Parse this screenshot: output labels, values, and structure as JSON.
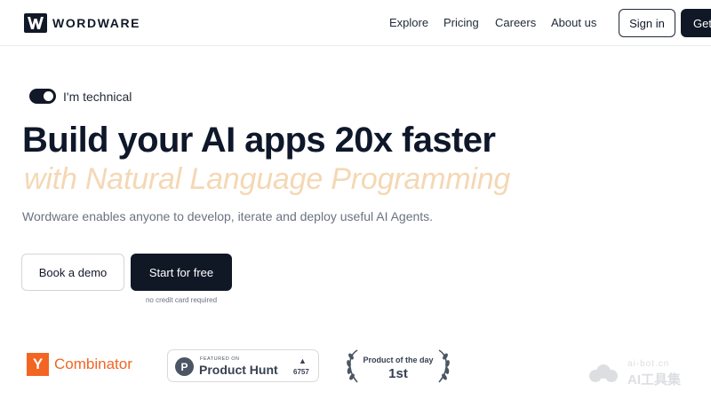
{
  "header": {
    "brand": "WORDWARE",
    "nav": {
      "explore": "Explore",
      "pricing": "Pricing",
      "careers": "Careers",
      "about": "About us"
    },
    "sign_in": "Sign in",
    "get_started": "Get"
  },
  "hero": {
    "toggle_label": "I'm technical",
    "toggle_on": true,
    "headline": "Build your AI apps 20x faster",
    "subheadline": "with Natural Language Programming",
    "description": "Wordware enables anyone to develop, iterate and deploy useful AI Agents.",
    "book_demo": "Book a demo",
    "start_free": "Start for free",
    "no_credit_card": "no credit card required"
  },
  "badges": {
    "ycombinator": {
      "letter": "Y",
      "text": "Combinator"
    },
    "producthunt": {
      "featured": "FEATURED ON",
      "name": "Product Hunt",
      "logo_letter": "P",
      "upvotes": "6757"
    },
    "potd": {
      "title": "Product of the day",
      "rank": "1st"
    }
  },
  "watermark": {
    "small": "ai-bot.cn",
    "big": "AI工具集"
  },
  "colors": {
    "brand_dark": "#101826",
    "accent_subheadline": "#f4d8b4",
    "ycombinator_orange": "#f26522"
  }
}
